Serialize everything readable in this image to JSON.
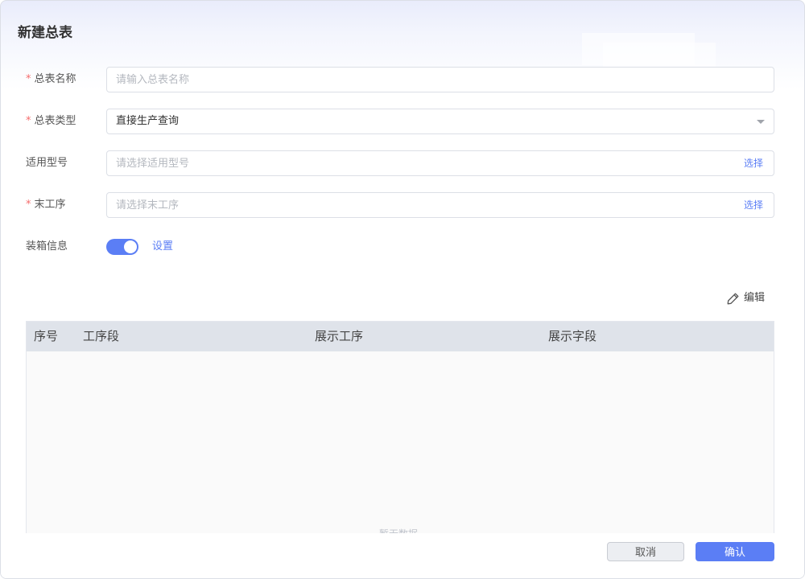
{
  "dialog": {
    "title": "新建总表"
  },
  "form": {
    "name": {
      "required_mark": "*",
      "label": "总表名称",
      "placeholder": "请输入总表名称",
      "value": ""
    },
    "type": {
      "required_mark": "*",
      "label": "总表类型",
      "value": "直接生产查询"
    },
    "model": {
      "label": "适用型号",
      "placeholder": "请选择适用型号",
      "action": "选择"
    },
    "last_process": {
      "required_mark": "*",
      "label": "末工序",
      "placeholder": "请选择末工序",
      "action": "选择"
    },
    "packing": {
      "label": "装箱信息",
      "enabled": true,
      "settings_label": "设置"
    }
  },
  "toolbar": {
    "edit_label": "编辑"
  },
  "table": {
    "columns": [
      "序号",
      "工序段",
      "展示工序",
      "展示字段"
    ],
    "rows": [],
    "empty_text": "暂无数据"
  },
  "footer": {
    "cancel_label": "取消",
    "confirm_label": "确认"
  },
  "colors": {
    "primary": "#5b7ef5",
    "required": "#f56c6c",
    "table_header": "#dfe3ea"
  },
  "icons": {
    "edit": "pencil-icon",
    "type_select": "caret-down-icon"
  }
}
